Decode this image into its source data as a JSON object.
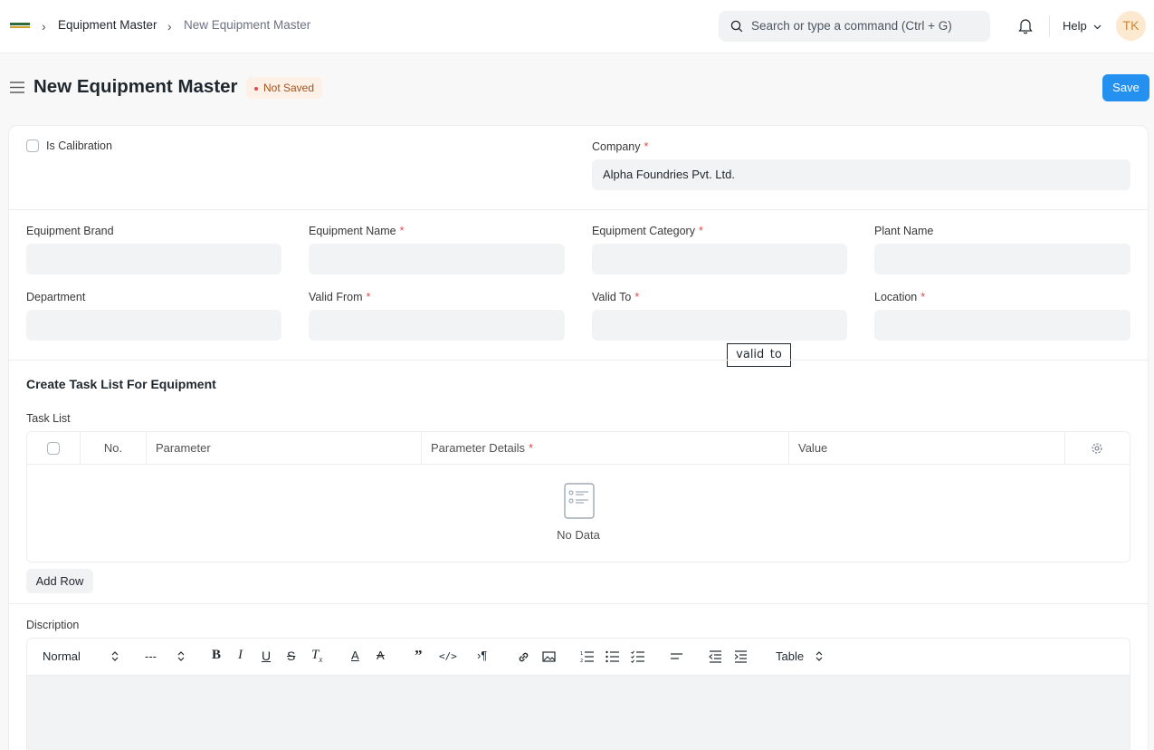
{
  "breadcrumb": {
    "parent": "Equipment Master",
    "current": "New Equipment Master"
  },
  "search": {
    "placeholder": "Search or type a command (Ctrl + G)"
  },
  "navbar": {
    "help_label": "Help",
    "avatar_initials": "TK"
  },
  "page": {
    "title": "New Equipment Master",
    "status": "Not Saved",
    "save_label": "Save"
  },
  "form": {
    "is_calibration_label": "Is Calibration",
    "company_label": "Company",
    "company_value": "Alpha Foundries Pvt. Ltd.",
    "equipment_brand_label": "Equipment Brand",
    "equipment_name_label": "Equipment Name",
    "equipment_category_label": "Equipment Category",
    "plant_name_label": "Plant Name",
    "department_label": "Department",
    "valid_from_label": "Valid From",
    "valid_to_label": "Valid To",
    "location_label": "Location",
    "tooltip": "valid_to",
    "task_section_title": "Create Task List For Equipment",
    "task_list_label": "Task List",
    "columns": {
      "no": "No.",
      "parameter": "Parameter",
      "parameter_details": "Parameter Details",
      "value": "Value"
    },
    "empty_text": "No Data",
    "add_row_label": "Add Row",
    "description_label": "Discription"
  },
  "editor": {
    "format": "Normal",
    "size": "---",
    "table": "Table"
  },
  "colors": {
    "primary": "#2490ef",
    "required": "#e24c4c",
    "status_bg": "#fdf1e7",
    "status_text": "#a3531f"
  }
}
